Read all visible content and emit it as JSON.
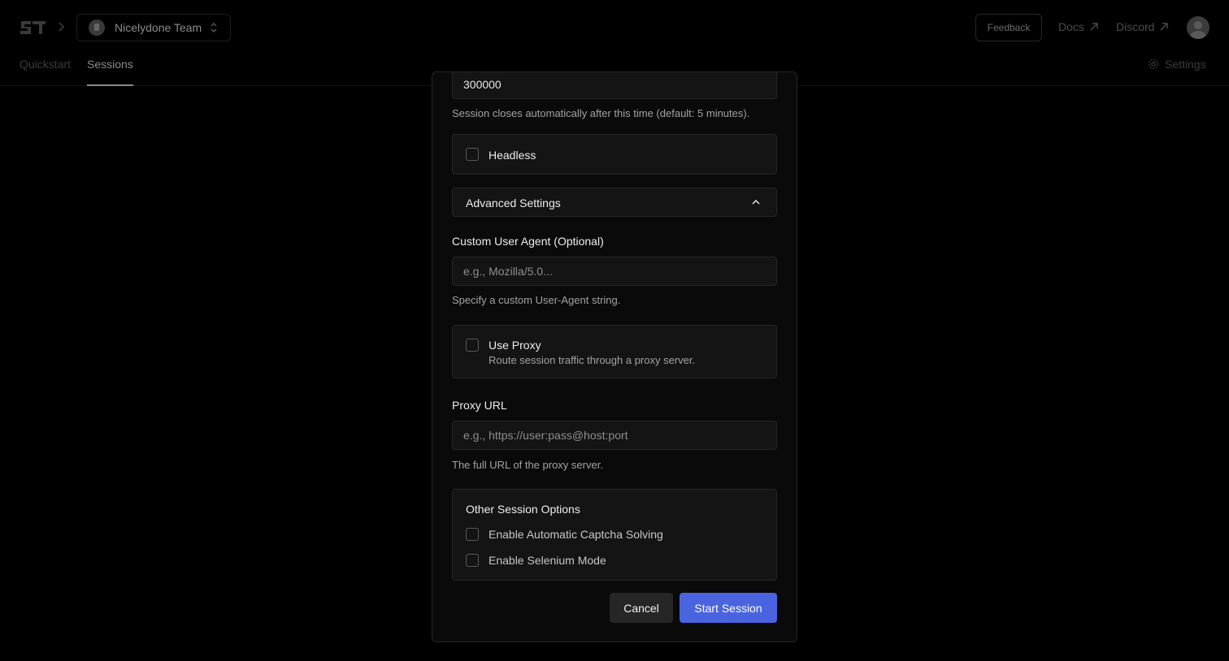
{
  "header": {
    "team_name": "Nicelydone Team",
    "feedback_label": "Feedback",
    "docs_label": "Docs",
    "discord_label": "Discord"
  },
  "tabs": [
    {
      "label": "Quickstart",
      "active": false
    },
    {
      "label": "Sessions",
      "active": true
    }
  ],
  "settings_label": "Settings",
  "modal": {
    "timeout": {
      "value": "300000",
      "hint": "Session closes automatically after this time (default: 5 minutes)."
    },
    "headless": {
      "label": "Headless",
      "checked": false
    },
    "advanced": {
      "label": "Advanced Settings",
      "expanded": true
    },
    "user_agent": {
      "label": "Custom User Agent (Optional)",
      "placeholder": "e.g., Mozilla/5.0...",
      "hint": "Specify a custom User-Agent string."
    },
    "proxy": {
      "label": "Use Proxy",
      "description": "Route session traffic through a proxy server.",
      "checked": false
    },
    "proxy_url": {
      "label": "Proxy URL",
      "placeholder": "e.g., https://user:pass@host:port",
      "hint": "The full URL of the proxy server."
    },
    "other_options": {
      "title": "Other Session Options",
      "options": [
        {
          "label": "Enable Automatic Captcha Solving",
          "checked": false
        },
        {
          "label": "Enable Selenium Mode",
          "checked": false
        }
      ]
    },
    "buttons": {
      "cancel": "Cancel",
      "start": "Start Session"
    }
  },
  "colors": {
    "primary": "#4a64e0",
    "overlay": "#000000",
    "surface": "#141414",
    "border": "#262626"
  }
}
